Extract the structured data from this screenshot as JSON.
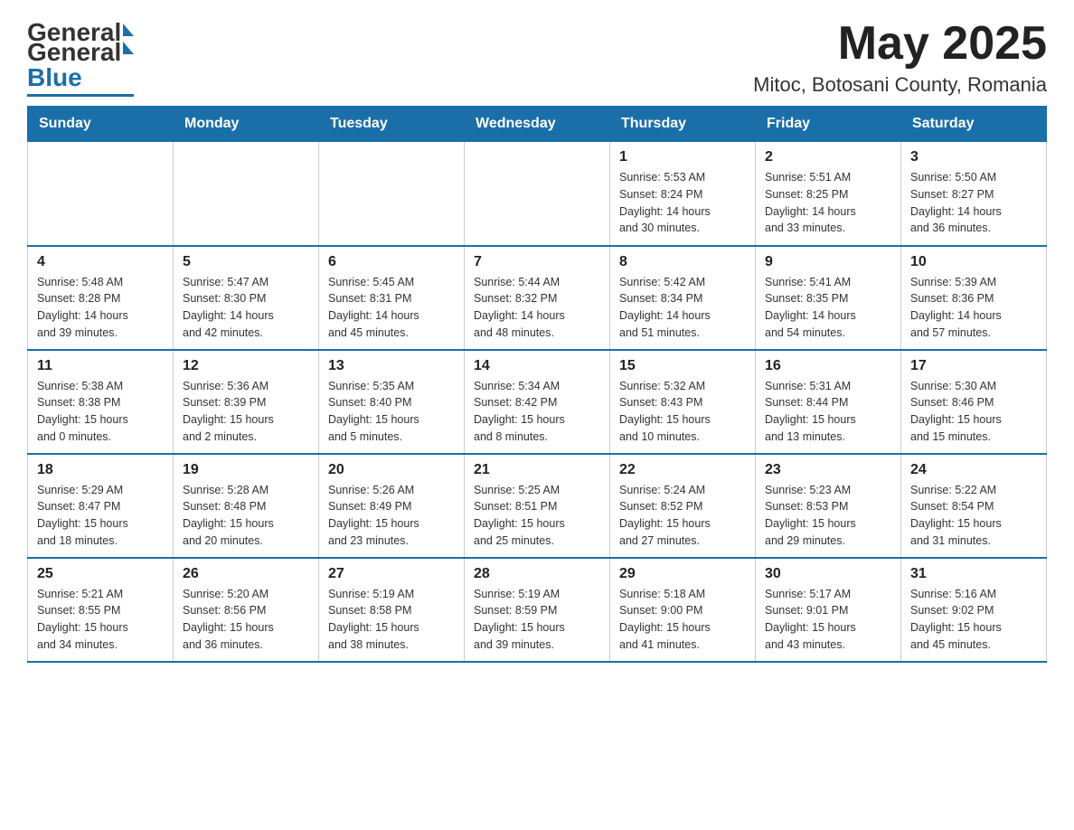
{
  "header": {
    "logo_general": "General",
    "logo_blue": "Blue",
    "month_year": "May 2025",
    "location": "Mitoc, Botosani County, Romania"
  },
  "weekdays": [
    "Sunday",
    "Monday",
    "Tuesday",
    "Wednesday",
    "Thursday",
    "Friday",
    "Saturday"
  ],
  "weeks": [
    [
      {
        "day": "",
        "info": ""
      },
      {
        "day": "",
        "info": ""
      },
      {
        "day": "",
        "info": ""
      },
      {
        "day": "",
        "info": ""
      },
      {
        "day": "1",
        "info": "Sunrise: 5:53 AM\nSunset: 8:24 PM\nDaylight: 14 hours\nand 30 minutes."
      },
      {
        "day": "2",
        "info": "Sunrise: 5:51 AM\nSunset: 8:25 PM\nDaylight: 14 hours\nand 33 minutes."
      },
      {
        "day": "3",
        "info": "Sunrise: 5:50 AM\nSunset: 8:27 PM\nDaylight: 14 hours\nand 36 minutes."
      }
    ],
    [
      {
        "day": "4",
        "info": "Sunrise: 5:48 AM\nSunset: 8:28 PM\nDaylight: 14 hours\nand 39 minutes."
      },
      {
        "day": "5",
        "info": "Sunrise: 5:47 AM\nSunset: 8:30 PM\nDaylight: 14 hours\nand 42 minutes."
      },
      {
        "day": "6",
        "info": "Sunrise: 5:45 AM\nSunset: 8:31 PM\nDaylight: 14 hours\nand 45 minutes."
      },
      {
        "day": "7",
        "info": "Sunrise: 5:44 AM\nSunset: 8:32 PM\nDaylight: 14 hours\nand 48 minutes."
      },
      {
        "day": "8",
        "info": "Sunrise: 5:42 AM\nSunset: 8:34 PM\nDaylight: 14 hours\nand 51 minutes."
      },
      {
        "day": "9",
        "info": "Sunrise: 5:41 AM\nSunset: 8:35 PM\nDaylight: 14 hours\nand 54 minutes."
      },
      {
        "day": "10",
        "info": "Sunrise: 5:39 AM\nSunset: 8:36 PM\nDaylight: 14 hours\nand 57 minutes."
      }
    ],
    [
      {
        "day": "11",
        "info": "Sunrise: 5:38 AM\nSunset: 8:38 PM\nDaylight: 15 hours\nand 0 minutes."
      },
      {
        "day": "12",
        "info": "Sunrise: 5:36 AM\nSunset: 8:39 PM\nDaylight: 15 hours\nand 2 minutes."
      },
      {
        "day": "13",
        "info": "Sunrise: 5:35 AM\nSunset: 8:40 PM\nDaylight: 15 hours\nand 5 minutes."
      },
      {
        "day": "14",
        "info": "Sunrise: 5:34 AM\nSunset: 8:42 PM\nDaylight: 15 hours\nand 8 minutes."
      },
      {
        "day": "15",
        "info": "Sunrise: 5:32 AM\nSunset: 8:43 PM\nDaylight: 15 hours\nand 10 minutes."
      },
      {
        "day": "16",
        "info": "Sunrise: 5:31 AM\nSunset: 8:44 PM\nDaylight: 15 hours\nand 13 minutes."
      },
      {
        "day": "17",
        "info": "Sunrise: 5:30 AM\nSunset: 8:46 PM\nDaylight: 15 hours\nand 15 minutes."
      }
    ],
    [
      {
        "day": "18",
        "info": "Sunrise: 5:29 AM\nSunset: 8:47 PM\nDaylight: 15 hours\nand 18 minutes."
      },
      {
        "day": "19",
        "info": "Sunrise: 5:28 AM\nSunset: 8:48 PM\nDaylight: 15 hours\nand 20 minutes."
      },
      {
        "day": "20",
        "info": "Sunrise: 5:26 AM\nSunset: 8:49 PM\nDaylight: 15 hours\nand 23 minutes."
      },
      {
        "day": "21",
        "info": "Sunrise: 5:25 AM\nSunset: 8:51 PM\nDaylight: 15 hours\nand 25 minutes."
      },
      {
        "day": "22",
        "info": "Sunrise: 5:24 AM\nSunset: 8:52 PM\nDaylight: 15 hours\nand 27 minutes."
      },
      {
        "day": "23",
        "info": "Sunrise: 5:23 AM\nSunset: 8:53 PM\nDaylight: 15 hours\nand 29 minutes."
      },
      {
        "day": "24",
        "info": "Sunrise: 5:22 AM\nSunset: 8:54 PM\nDaylight: 15 hours\nand 31 minutes."
      }
    ],
    [
      {
        "day": "25",
        "info": "Sunrise: 5:21 AM\nSunset: 8:55 PM\nDaylight: 15 hours\nand 34 minutes."
      },
      {
        "day": "26",
        "info": "Sunrise: 5:20 AM\nSunset: 8:56 PM\nDaylight: 15 hours\nand 36 minutes."
      },
      {
        "day": "27",
        "info": "Sunrise: 5:19 AM\nSunset: 8:58 PM\nDaylight: 15 hours\nand 38 minutes."
      },
      {
        "day": "28",
        "info": "Sunrise: 5:19 AM\nSunset: 8:59 PM\nDaylight: 15 hours\nand 39 minutes."
      },
      {
        "day": "29",
        "info": "Sunrise: 5:18 AM\nSunset: 9:00 PM\nDaylight: 15 hours\nand 41 minutes."
      },
      {
        "day": "30",
        "info": "Sunrise: 5:17 AM\nSunset: 9:01 PM\nDaylight: 15 hours\nand 43 minutes."
      },
      {
        "day": "31",
        "info": "Sunrise: 5:16 AM\nSunset: 9:02 PM\nDaylight: 15 hours\nand 45 minutes."
      }
    ]
  ]
}
